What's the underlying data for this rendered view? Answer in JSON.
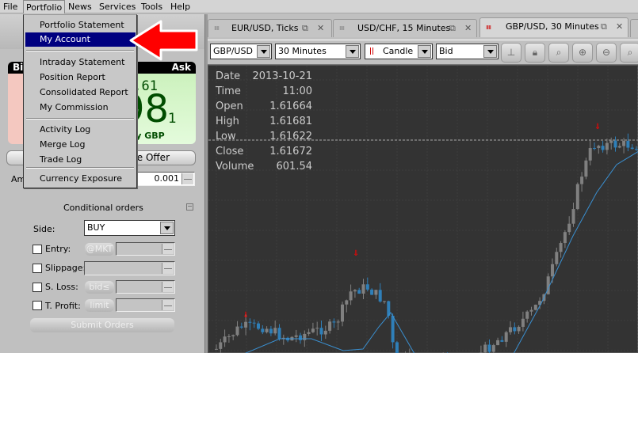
{
  "menubar": {
    "items": [
      "File",
      "Portfolio",
      "News",
      "Services",
      "Tools",
      "Help"
    ]
  },
  "portfolio_menu": {
    "items": [
      {
        "label": "Portfolio Statement"
      },
      {
        "label": "My Account",
        "highlighted": true
      },
      {
        "label": "Intraday Statement"
      },
      {
        "label": "Position Report"
      },
      {
        "label": "Consolidated Report"
      },
      {
        "label": "My Commission"
      },
      {
        "label": "Activity Log"
      },
      {
        "label": "Merge Log"
      },
      {
        "label": "Trade Log"
      },
      {
        "label": "Currency Exposure"
      }
    ]
  },
  "annotation": {
    "arrow_color": "#ff0000",
    "points_to": "My Account"
  },
  "quote": {
    "bid_label": "Bid",
    "ask_label": "Ask",
    "ask_big_prefix": "1.61",
    "ask_big": "98",
    "ask_pip": "1",
    "ask_action": "Buy GBP",
    "offer_button": "Place Offer",
    "amount_label": "Amount",
    "amount_value": "0.001",
    "bid_color": "#f4c8c0",
    "ask_color": "#d4f7c8"
  },
  "conditional": {
    "title": "Conditional orders",
    "side_label": "Side:",
    "side_value": "BUY",
    "rows": [
      {
        "label": "Entry:",
        "button": "@MKT"
      },
      {
        "label": "Slippage:"
      },
      {
        "label": "S. Loss:",
        "button": "bid≤"
      },
      {
        "label": "T. Profit:",
        "button": "limit"
      }
    ],
    "submit": "Submit Orders"
  },
  "tabs": [
    {
      "label": "EUR/USD,  Ticks"
    },
    {
      "label": "USD/CHF,  15 Minutes"
    },
    {
      "label": "GBP/USD,  30 Minutes",
      "selected": true
    }
  ],
  "chart_toolbar": {
    "instrument": "GBP/USD",
    "period": "30 Minutes",
    "chart_type": "Candle",
    "side": "Bid",
    "tools": [
      "axis-icon",
      "lock-icon",
      "zoom-fit-icon",
      "zoom-in-icon",
      "zoom-out-icon",
      "zoom-area-icon"
    ]
  },
  "chart_info": [
    {
      "k": "Date",
      "v": "2013-10-21"
    },
    {
      "k": "Time",
      "v": "11:00"
    },
    {
      "k": "Open",
      "v": "1.61664"
    },
    {
      "k": "High",
      "v": "1.61681"
    },
    {
      "k": "Low",
      "v": "1.61622"
    },
    {
      "k": "Close",
      "v": "1.61672"
    },
    {
      "k": "Volume",
      "v": "601.54"
    }
  ],
  "chart_colors": {
    "background": "#333333",
    "bull": "#808080",
    "bear": "#2f7fb8",
    "ma": "#3a8fd0",
    "marker": "#ff0000"
  }
}
